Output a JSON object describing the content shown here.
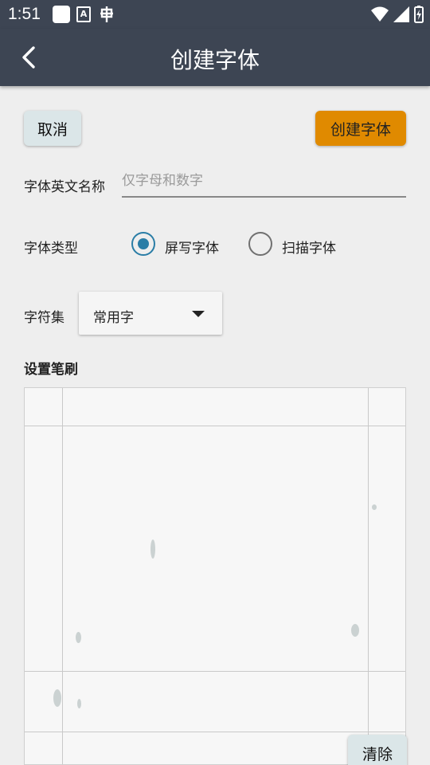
{
  "status_bar": {
    "time": "1:51",
    "a_badge": "A"
  },
  "app_bar": {
    "title": "创建字体"
  },
  "actions": {
    "cancel_label": "取消",
    "create_label": "创建字体"
  },
  "form": {
    "name_label": "字体英文名称",
    "name_value": "",
    "name_placeholder": "仅字母和数字",
    "type_label": "字体类型",
    "type_options": [
      {
        "label": "屏写字体",
        "selected": true
      },
      {
        "label": "扫描字体",
        "selected": false
      }
    ],
    "charset_label": "字符集",
    "charset_value": "常用字"
  },
  "brush": {
    "heading": "设置笔刷",
    "clear_label": "清除"
  },
  "colors": {
    "bar": "#3d4553",
    "accent": "#e08a00",
    "radio": "#2a7da6",
    "button": "#dbe6e8"
  }
}
